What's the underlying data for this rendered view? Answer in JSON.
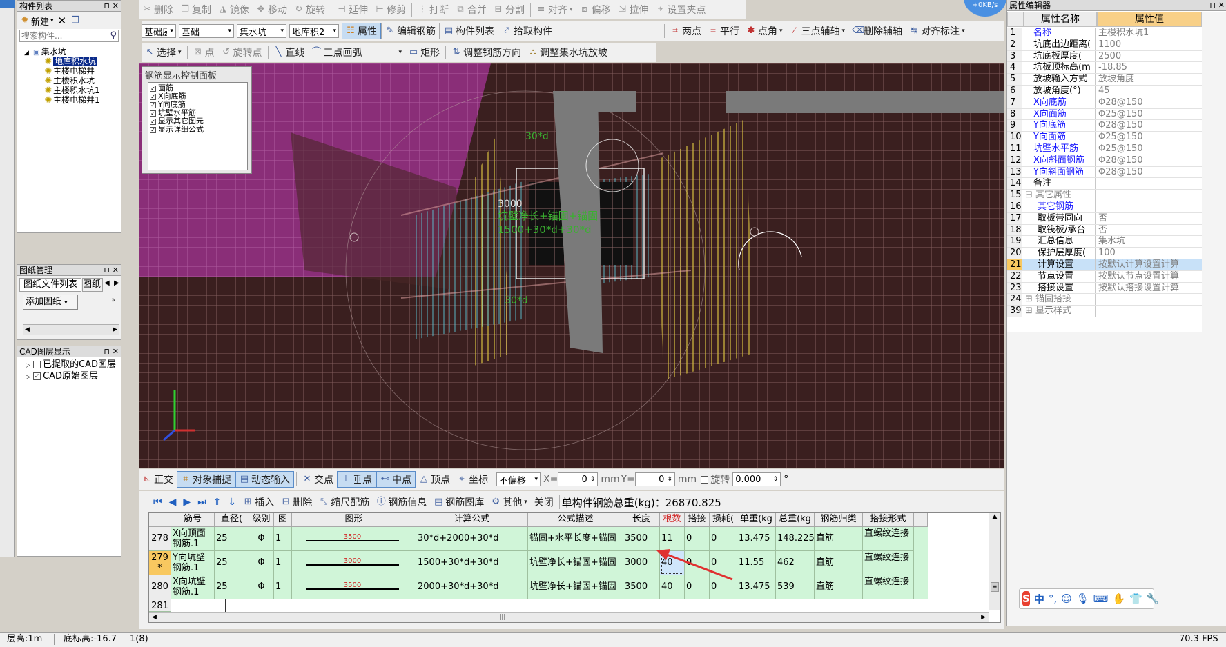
{
  "left_panel": {
    "title": "构件列表",
    "new_label": "新建",
    "search_placeholder": "搜索构件...",
    "tree_root": "集水坑",
    "tree_items": [
      "地库积水坑",
      "主楼电梯井",
      "主楼积水坑",
      "主楼积水坑1",
      "主楼电梯井1"
    ]
  },
  "drawing_panel": {
    "title": "图纸管理",
    "tab1": "图纸文件列表",
    "tab2": "图纸",
    "add_label": "添加图纸"
  },
  "cad_panel": {
    "title": "CAD图层显示",
    "items": [
      "已提取的CAD图层",
      "CAD原始图层"
    ]
  },
  "toolbar1": {
    "items": [
      "删除",
      "复制",
      "镜像",
      "移动",
      "旋转",
      "延伸",
      "修剪",
      "打断",
      "合并",
      "分割",
      "对齐",
      "偏移",
      "拉伸",
      "设置夹点"
    ]
  },
  "toolbar2": {
    "combo1": "基础层",
    "combo2": "基础",
    "combo3": "集水坑",
    "combo4": "地库积2",
    "items": [
      "属性",
      "编辑钢筋",
      "构件列表",
      "拾取构件"
    ],
    "right_items": [
      "两点",
      "平行",
      "点角",
      "三点辅轴",
      "删除辅轴",
      "对齐标注"
    ]
  },
  "toolbar3": {
    "items": [
      "选择",
      "点",
      "旋转点",
      "直线",
      "三点画弧",
      "矩形",
      "调整钢筋方向",
      "调整集水坑放坡"
    ]
  },
  "rebar_panel": {
    "title": "钢筋显示控制面板",
    "items": [
      "面筋",
      "X向底筋",
      "Y向底筋",
      "坑壁水平筋",
      "显示其它图元",
      "显示详细公式"
    ]
  },
  "viewport_labels": {
    "top_anchor": "30*d",
    "num": "3000",
    "desc": "坑壁净长+锚固+锚固",
    "formula": "1500+30*d+30*d",
    "bottom_anchor": "30*d"
  },
  "snap_bar": {
    "items": [
      "正交",
      "对象捕捉",
      "动态输入",
      "交点",
      "垂点",
      "中点",
      "顶点",
      "坐标"
    ],
    "offset_combo": "不偏移",
    "x_label": "X=",
    "x_value": "0",
    "x_unit": "mm",
    "y_label": "Y=",
    "y_value": "0",
    "y_unit": "mm",
    "rotate_label": "旋转",
    "rotate_value": "0.000",
    "deg": "°"
  },
  "grid_toolbar": {
    "items": [
      "插入",
      "删除",
      "缩尺配筋",
      "钢筋信息",
      "钢筋图库",
      "其他",
      "关闭"
    ],
    "total_label": "单构件钢筋总重(kg)：26870.825"
  },
  "grid": {
    "headers": [
      "筋号",
      "直径(",
      "级别",
      "图",
      "图形",
      "计算公式",
      "公式描述",
      "长度(mm",
      "根数",
      "搭接",
      "损耗(",
      "单重(kg",
      "总重(kg",
      "钢筋归类",
      "搭接形式"
    ],
    "rows": [
      {
        "num": "278",
        "name": "X向顶面钢筋.1",
        "dia": "25",
        "grade": "Φ",
        "fig": "1",
        "shape_len": "3500",
        "formula": "30*d+2000+30*d",
        "desc": "锚固+水平长度+锚固",
        "len": "3500",
        "count": "11",
        "lap": "0",
        "loss": "0",
        "unit_w": "13.475",
        "total_w": "148.225",
        "cat": "直筋",
        "lap_type": "直螺纹连接"
      },
      {
        "num": "279",
        "mark": "*",
        "name": "Y向坑壁钢筋.1",
        "dia": "25",
        "grade": "Φ",
        "fig": "1",
        "shape_len": "3000",
        "formula": "1500+30*d+30*d",
        "desc": "坑壁净长+锚固+锚固",
        "len": "3000",
        "count": "40",
        "lap": "0",
        "loss": "0",
        "unit_w": "11.55",
        "total_w": "462",
        "cat": "直筋",
        "lap_type": "直螺纹连接"
      },
      {
        "num": "280",
        "name": "X向坑壁钢筋.1",
        "dia": "25",
        "grade": "Φ",
        "fig": "1",
        "shape_len": "3500",
        "formula": "2000+30*d+30*d",
        "desc": "坑壁净长+锚固+锚固",
        "len": "3500",
        "count": "40",
        "lap": "0",
        "loss": "0",
        "unit_w": "13.475",
        "total_w": "539",
        "cat": "直筋",
        "lap_type": "直螺纹连接"
      },
      {
        "num": "281"
      }
    ]
  },
  "props": {
    "title": "属性编辑器",
    "col_name": "属性名称",
    "col_value": "属性值",
    "rows": [
      {
        "n": "1",
        "name": "名称",
        "val": "主楼积水坑1",
        "blue": true
      },
      {
        "n": "2",
        "name": "坑底出边距离(",
        "val": "1100"
      },
      {
        "n": "3",
        "name": "坑底板厚度(",
        "val": "2500"
      },
      {
        "n": "4",
        "name": "坑板顶标高(m",
        "val": "-18.85"
      },
      {
        "n": "5",
        "name": "放坡输入方式",
        "val": "放坡角度"
      },
      {
        "n": "6",
        "name": "放坡角度(°)",
        "val": "45"
      },
      {
        "n": "7",
        "name": "X向底筋",
        "val": "Φ28@150",
        "blue": true
      },
      {
        "n": "8",
        "name": "X向面筋",
        "val": "Φ25@150",
        "blue": true
      },
      {
        "n": "9",
        "name": "Y向底筋",
        "val": "Φ28@150",
        "blue": true
      },
      {
        "n": "10",
        "name": "Y向面筋",
        "val": "Φ25@150",
        "blue": true
      },
      {
        "n": "11",
        "name": "坑壁水平筋",
        "val": "Φ25@150",
        "blue": true
      },
      {
        "n": "12",
        "name": "X向斜面钢筋",
        "val": "Φ28@150",
        "blue": true
      },
      {
        "n": "13",
        "name": "Y向斜面钢筋",
        "val": "Φ28@150",
        "blue": true
      },
      {
        "n": "14",
        "name": "备注",
        "val": ""
      },
      {
        "n": "15",
        "name": "其它属性",
        "val": "",
        "group": true
      },
      {
        "n": "16",
        "name": "其它钢筋",
        "val": "",
        "blue": true,
        "indent": true
      },
      {
        "n": "17",
        "name": "取板带同向",
        "val": "否",
        "indent": true
      },
      {
        "n": "18",
        "name": "取筏板/承台",
        "val": "否",
        "indent": true
      },
      {
        "n": "19",
        "name": "汇总信息",
        "val": "集水坑",
        "indent": true
      },
      {
        "n": "20",
        "name": "保护层厚度(",
        "val": "100",
        "indent": true
      },
      {
        "n": "21",
        "name": "计算设置",
        "val": "按默认计算设置计算",
        "indent": true,
        "sel": true
      },
      {
        "n": "22",
        "name": "节点设置",
        "val": "按默认节点设置计算",
        "indent": true
      },
      {
        "n": "23",
        "name": "搭接设置",
        "val": "按默认搭接设置计算",
        "indent": true
      },
      {
        "n": "24",
        "name": "锚固搭接",
        "val": "",
        "group": true
      },
      {
        "n": "39",
        "name": "显示样式",
        "val": "",
        "group": true
      }
    ]
  },
  "status": {
    "floor": "层高:1m",
    "base": "底标高:-16.7",
    "extra": "1(8)",
    "fps": "70.3 FPS"
  },
  "net_badge": "+0KB/s",
  "ime": {
    "lang": "中"
  }
}
